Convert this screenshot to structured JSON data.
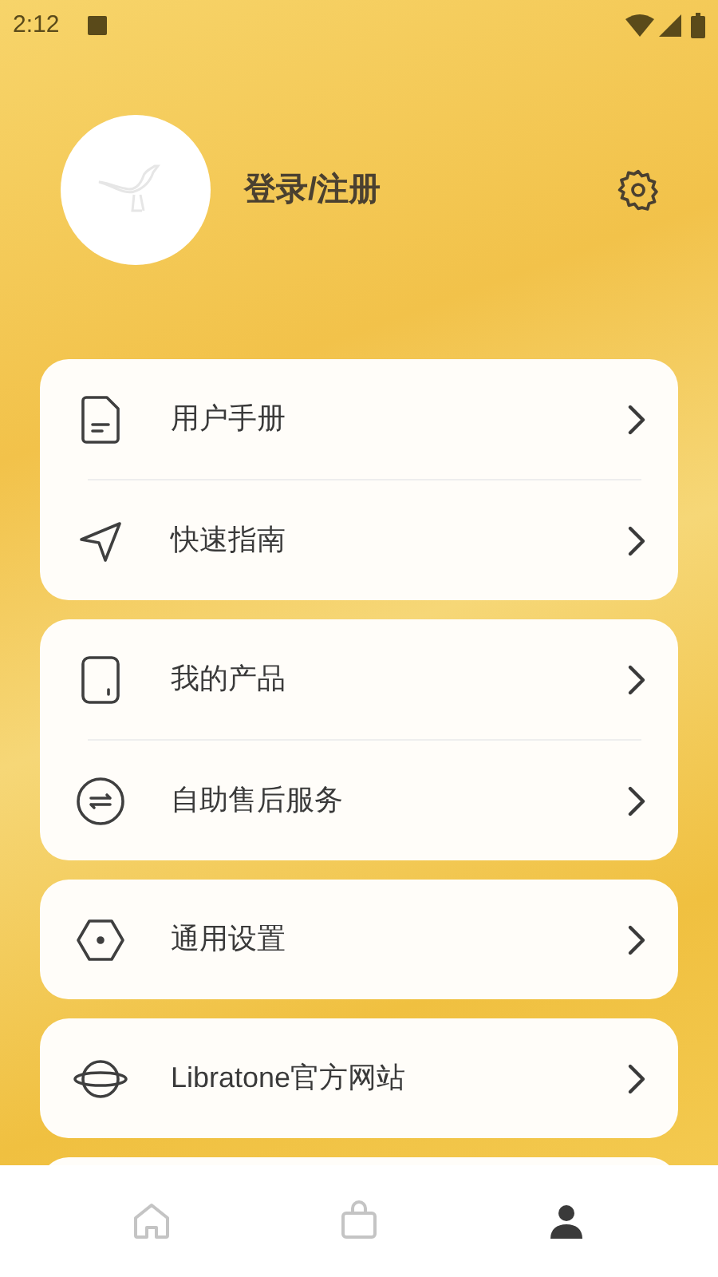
{
  "status_bar": {
    "time": "2:12"
  },
  "profile": {
    "login": "登录/注册"
  },
  "groups": [
    {
      "items": [
        {
          "label": "用户手册"
        },
        {
          "label": "快速指南"
        }
      ]
    },
    {
      "items": [
        {
          "label": "我的产品"
        },
        {
          "label": "自助售后服务"
        }
      ]
    },
    {
      "items": [
        {
          "label": "通用设置"
        }
      ]
    },
    {
      "items": [
        {
          "label": "Libratone官方网站"
        }
      ]
    }
  ],
  "nav": [
    {
      "selected": false
    },
    {
      "selected": false
    },
    {
      "selected": true
    }
  ]
}
